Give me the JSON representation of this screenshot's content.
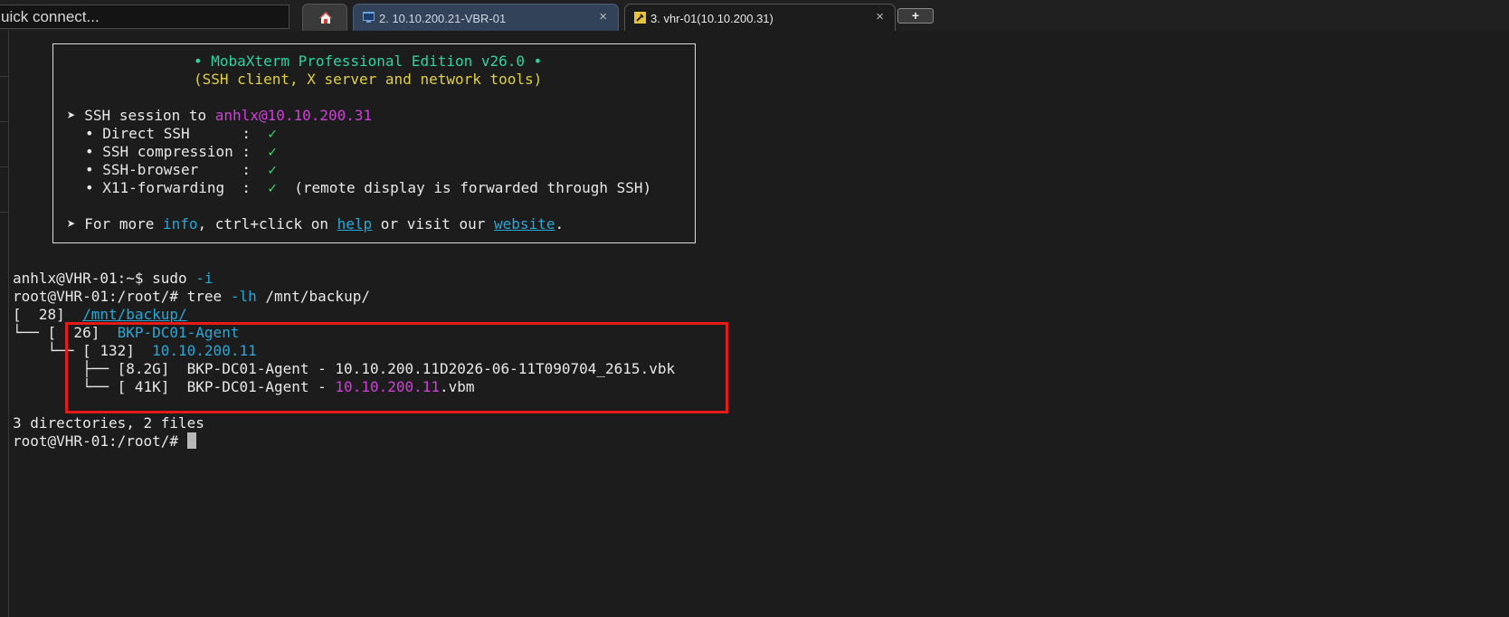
{
  "quick_connect": {
    "value": "uick connect..."
  },
  "tabs": [
    {
      "label": "",
      "icon": "home-icon"
    },
    {
      "label": "2. 10.10.200.21-VBR-01",
      "icon": "windows-rdp-icon"
    },
    {
      "label": "3. vhr-01(10.10.200.31)",
      "icon": "ssh-key-icon"
    }
  ],
  "tab_close": "×",
  "add_tab_label": "+",
  "banner": {
    "title": "• MobaXterm Professional Edition v26.0 •",
    "subtitle": "(SSH client, X server and network tools)",
    "arrow": "➤",
    "session_prefix": "SSH session to ",
    "session_target": "anhlx@10.10.200.31",
    "features": [
      {
        "label": "• Direct SSH      :  ",
        "check": "✓",
        "note": ""
      },
      {
        "label": "• SSH compression :  ",
        "check": "✓",
        "note": ""
      },
      {
        "label": "• SSH-browser     :  ",
        "check": "✓",
        "note": ""
      },
      {
        "label": "• X11-forwarding  :  ",
        "check": "✓",
        "note": "  (remote display is forwarded through SSH)"
      }
    ],
    "more": {
      "p1": "For more ",
      "info": "info",
      "p2": ", ctrl+click on ",
      "help": "help",
      "p3": " or visit our ",
      "website": "website",
      "p4": "."
    }
  },
  "terminal": {
    "cmd1_prompt": "anhlx@VHR-01:~$ ",
    "cmd1": "sudo ",
    "cmd1_flag": "-i",
    "cmd2_prompt": "root@VHR-01:/root/# ",
    "cmd2": "tree ",
    "cmd2_flag": "-lh",
    "cmd2_arg": " /mnt/backup/",
    "tree": {
      "root_size": "[  28]  ",
      "root_dir": "/mnt/backup/",
      "l1_branch": "└── ",
      "l1_size": "[  26]  ",
      "l1_dir": "BKP-DC01-Agent",
      "l2_branch": "    └── ",
      "l2_size": "[ 132]  ",
      "l2_dir": "10.10.200.11",
      "f1_branch": "        ├── ",
      "f1_size": "[8.2G]  ",
      "f1_name": "BKP-DC01-Agent - 10.10.200.11D2026-06-11T090704_2615.vbk",
      "f2_branch": "        └── ",
      "f2_size": "[ 41K]  ",
      "f2_pre": "BKP-DC01-Agent - ",
      "f2_ip": "10.10.200.11",
      "f2_ext": ".vbm"
    },
    "summary": "3 directories, 2 files",
    "final_prompt": "root@VHR-01:/root/# "
  },
  "colors": {
    "highlight_box": "#e41b17",
    "banner_green": "#2fd3a0",
    "banner_yellow": "#e0d046",
    "magenta": "#d040d8",
    "cyan": "#29a8d8"
  }
}
